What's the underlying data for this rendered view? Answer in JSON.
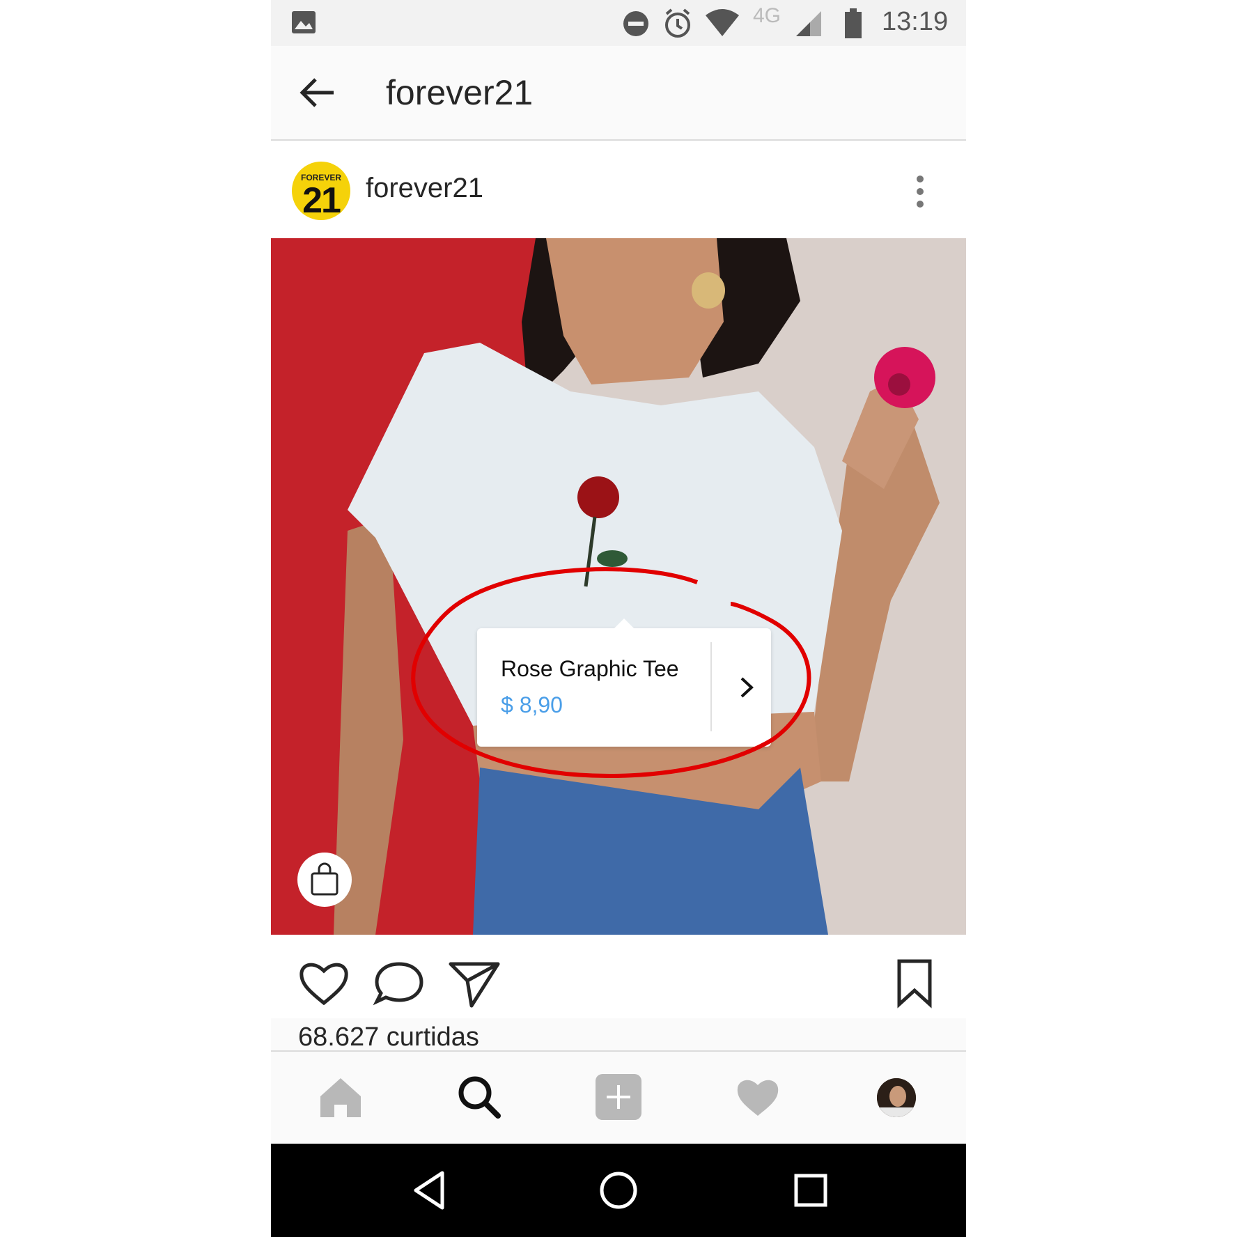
{
  "status_bar": {
    "time": "13:19",
    "network": "4G",
    "icons": [
      "image-icon",
      "do-not-disturb-icon",
      "alarm-icon",
      "wifi-icon",
      "signal-icon",
      "battery-icon"
    ]
  },
  "header": {
    "title": "forever21",
    "back_icon": "arrow-left-icon"
  },
  "post": {
    "username": "forever21",
    "avatar": {
      "top_text": "FOREVER",
      "number": "21",
      "color": "#f5d20a"
    },
    "product_tag": {
      "name": "Rose Graphic Tee",
      "price": "$ 8,90",
      "price_color": "#4a9ee8"
    },
    "annotation_color": "#e10000",
    "likes": "68.627 curtidas"
  },
  "actions": [
    "heart-icon",
    "comment-icon",
    "share-icon",
    "bookmark-icon"
  ],
  "bottom_nav": [
    "home-icon",
    "search-icon",
    "add-icon",
    "activity-heart-icon",
    "profile-icon"
  ],
  "android_nav": [
    "back-triangle-icon",
    "home-circle-icon",
    "recents-square-icon"
  ]
}
